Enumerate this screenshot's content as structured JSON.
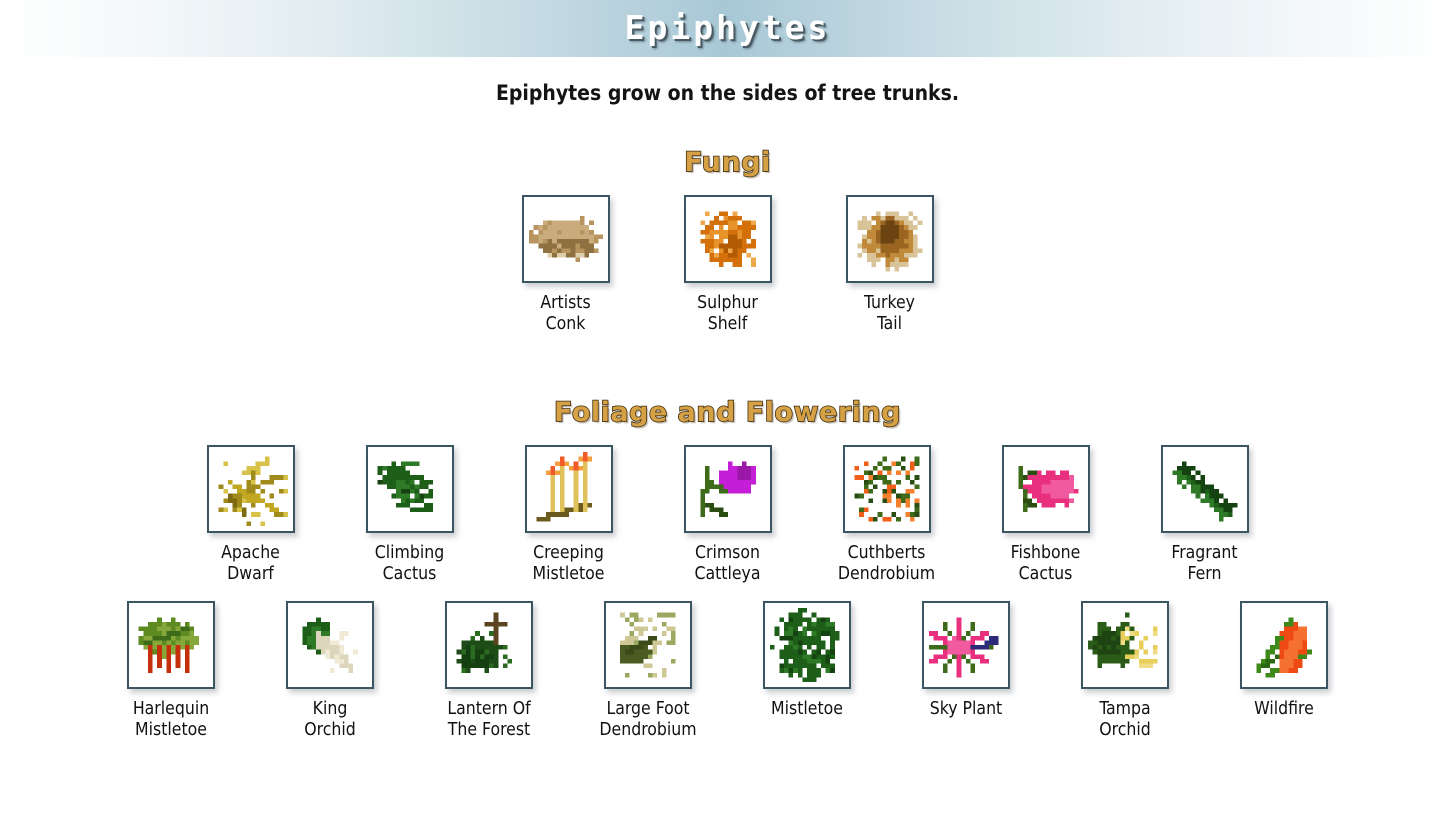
{
  "header": {
    "title": "Epiphytes"
  },
  "intro": {
    "text": "Epiphytes grow on the sides of tree trunks."
  },
  "colors": {
    "heading_fill": "#d6a144",
    "heading_outline": "#3c2c12",
    "tile_border": "#3c5563",
    "page_background": "#ffffff",
    "header_gradient_center": "#a8c8d6",
    "label_text": "#111111"
  },
  "sections": [
    {
      "id": "fungi",
      "heading": "Fungi",
      "rows": [
        [
          {
            "name": "Artists\nConk",
            "icon": "artists-conk",
            "palette": [
              "#b8945e",
              "#c9ab7d",
              "#8f7040",
              "#e0cfae"
            ]
          },
          {
            "name": "Sulphur\nShelf",
            "icon": "sulphur-shelf",
            "palette": [
              "#d4700a",
              "#e8922a",
              "#b35a05",
              "#f0a94a"
            ]
          },
          {
            "name": "Turkey\nTail",
            "icon": "turkey-tail",
            "palette": [
              "#9a6520",
              "#c08a3a",
              "#6b4412",
              "#d9c49a"
            ]
          }
        ]
      ]
    },
    {
      "id": "foliage-and-flowering",
      "heading": "Foliage and Flowering",
      "rows": [
        [
          {
            "name": "Apache\nDwarf",
            "icon": "apache-dwarf",
            "palette": [
              "#a08a1a",
              "#c2a722",
              "#7d6a10",
              "#d8c24a"
            ]
          },
          {
            "name": "Climbing\nCactus",
            "icon": "climbing-cactus",
            "palette": [
              "#1d5e18",
              "#2f7a26",
              "#144211",
              "#3f9033"
            ]
          },
          {
            "name": "Creeping\nMistletoe",
            "icon": "creeping-mistletoe",
            "palette": [
              "#e0c25c",
              "#f25a2a",
              "#6b5b1e",
              "#f5a03c"
            ]
          },
          {
            "name": "Crimson\nCattleya",
            "icon": "crimson-cattleya",
            "palette": [
              "#3d6b1a",
              "#c41fd6",
              "#2a4d12",
              "#9a17a8"
            ]
          },
          {
            "name": "Cuthberts\nDendrobium",
            "icon": "cuthberts-dendrobium",
            "palette": [
              "#3d6b1a",
              "#ef5f18",
              "#2a4d12",
              "#f5812f"
            ]
          },
          {
            "name": "Fishbone\nCactus",
            "icon": "fishbone-cactus",
            "palette": [
              "#3d6b1a",
              "#e8307f",
              "#2a4d12",
              "#f25aa0"
            ]
          },
          {
            "name": "Fragrant\nFern",
            "icon": "fragrant-fern",
            "palette": [
              "#1d5e18",
              "#2f7a26",
              "#144211",
              "#3f9033"
            ]
          }
        ],
        [
          {
            "name": "Harlequin\nMistletoe",
            "icon": "harlequin-mistletoe",
            "palette": [
              "#5e8a22",
              "#c4300c",
              "#3d6b1a",
              "#86a83a"
            ]
          },
          {
            "name": "King\nOrchid",
            "icon": "king-orchid",
            "palette": [
              "#1d5e18",
              "#ddd6bc",
              "#2f7a26",
              "#efe9d6"
            ]
          },
          {
            "name": "Lantern Of\nThe Forest",
            "icon": "lantern-of-the-forest",
            "palette": [
              "#1d4c16",
              "#5c4420",
              "#2a6b20",
              "#143f10"
            ]
          },
          {
            "name": "Large Foot\nDendrobium",
            "icon": "large-foot-dendrobium",
            "palette": [
              "#4a5c22",
              "#cdc894",
              "#3a4a18",
              "#9aa860"
            ]
          },
          {
            "name": "Mistletoe",
            "icon": "mistletoe",
            "palette": [
              "#1d5e18",
              "#2f7a26",
              "#144211",
              "#3f9033"
            ]
          },
          {
            "name": "Sky Plant",
            "icon": "sky-plant",
            "palette": [
              "#e8307f",
              "#3d6b1a",
              "#2b2b7a",
              "#f25aa0"
            ]
          },
          {
            "name": "Tampa\nOrchid",
            "icon": "tampa-orchid",
            "palette": [
              "#2a5c18",
              "#e8cf5c",
              "#1d4412",
              "#f0dc84"
            ]
          },
          {
            "name": "Wildfire",
            "icon": "wildfire",
            "palette": [
              "#3d8a1a",
              "#f04a14",
              "#2a6b12",
              "#f5712f"
            ]
          }
        ]
      ]
    }
  ]
}
